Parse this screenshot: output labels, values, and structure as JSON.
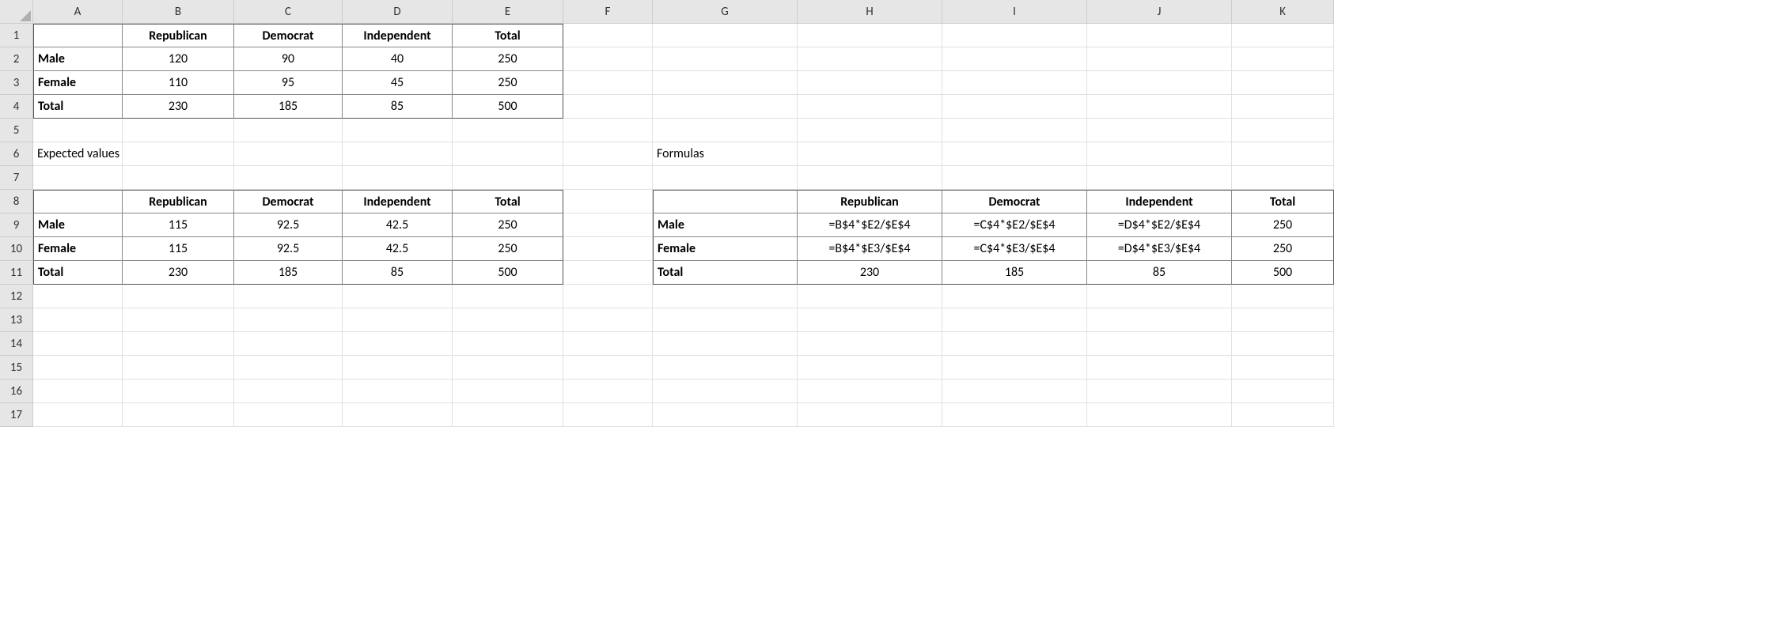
{
  "columns": [
    "A",
    "B",
    "C",
    "D",
    "E",
    "F",
    "G",
    "H",
    "I",
    "J",
    "K"
  ],
  "rows": [
    "1",
    "2",
    "3",
    "4",
    "5",
    "6",
    "7",
    "8",
    "9",
    "10",
    "11",
    "12",
    "13",
    "14",
    "15",
    "16",
    "17"
  ],
  "labels": {
    "expected": "Expected values",
    "formulas": "Formulas"
  },
  "observed": {
    "headers": [
      "",
      "Republican",
      "Democrat",
      "Independent",
      "Total"
    ],
    "rows": [
      [
        "Male",
        "120",
        "90",
        "40",
        "250"
      ],
      [
        "Female",
        "110",
        "95",
        "45",
        "250"
      ],
      [
        "Total",
        "230",
        "185",
        "85",
        "500"
      ]
    ]
  },
  "expected": {
    "headers": [
      "",
      "Republican",
      "Democrat",
      "Independent",
      "Total"
    ],
    "rows": [
      [
        "Male",
        "115",
        "92.5",
        "42.5",
        "250"
      ],
      [
        "Female",
        "115",
        "92.5",
        "42.5",
        "250"
      ],
      [
        "Total",
        "230",
        "185",
        "85",
        "500"
      ]
    ]
  },
  "formulas": {
    "headers": [
      "",
      "Republican",
      "Democrat",
      "Independent",
      "Total"
    ],
    "rows": [
      [
        "Male",
        "=B$4*$E2/$E$4",
        "=C$4*$E2/$E$4",
        "=D$4*$E2/$E$4",
        "250"
      ],
      [
        "Female",
        "=B$4*$E3/$E$4",
        "=C$4*$E3/$E$4",
        "=D$4*$E3/$E$4",
        "250"
      ],
      [
        "Total",
        "230",
        "185",
        "85",
        "500"
      ]
    ]
  }
}
